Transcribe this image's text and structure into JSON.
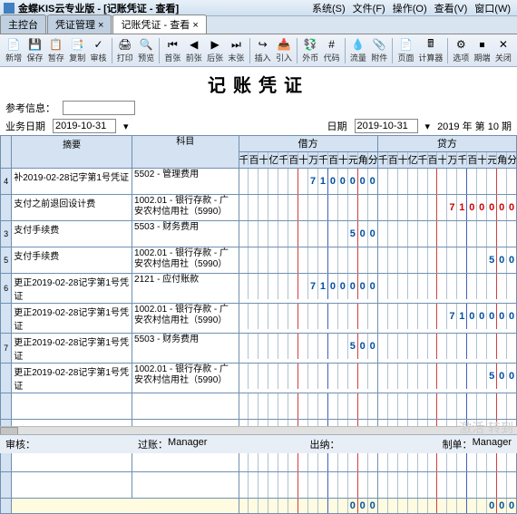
{
  "window": {
    "title": "金蝶KIS云专业版 - [记账凭证 - 查看]",
    "menus": [
      "系统(S)",
      "文件(F)",
      "操作(O)",
      "查看(V)",
      "窗口(W)"
    ]
  },
  "tabs": [
    {
      "label": "主控台",
      "active": false
    },
    {
      "label": "凭证管理 ×",
      "active": false
    },
    {
      "label": "记账凭证 - 查看 ×",
      "active": true
    }
  ],
  "toolbar": [
    {
      "name": "new",
      "icon": "📄",
      "label": "新增"
    },
    {
      "name": "save",
      "icon": "💾",
      "label": "保存"
    },
    {
      "name": "saveas",
      "icon": "📋",
      "label": "暂存"
    },
    {
      "name": "copy",
      "icon": "📑",
      "label": "复制"
    },
    {
      "name": "check",
      "icon": "✓",
      "label": "审核"
    },
    {
      "sep": true
    },
    {
      "name": "print",
      "icon": "🖨",
      "label": "打印"
    },
    {
      "name": "preview",
      "icon": "🔍",
      "label": "预览"
    },
    {
      "sep": true
    },
    {
      "name": "first",
      "icon": "⏮",
      "label": "首张"
    },
    {
      "name": "prev",
      "icon": "◀",
      "label": "前张"
    },
    {
      "name": "next",
      "icon": "▶",
      "label": "后张"
    },
    {
      "name": "last",
      "icon": "⏭",
      "label": "末张"
    },
    {
      "sep": true
    },
    {
      "name": "insert",
      "icon": "↪",
      "label": "插入"
    },
    {
      "name": "import",
      "icon": "📥",
      "label": "引入"
    },
    {
      "sep": true
    },
    {
      "name": "fx",
      "icon": "💱",
      "label": "外币"
    },
    {
      "name": "code",
      "icon": "#",
      "label": "代码"
    },
    {
      "sep": true
    },
    {
      "name": "flow",
      "icon": "💧",
      "label": "流量"
    },
    {
      "name": "attach",
      "icon": "📎",
      "label": "附件"
    },
    {
      "sep": true
    },
    {
      "name": "page",
      "icon": "📄",
      "label": "页面"
    },
    {
      "name": "calc",
      "icon": "🖩",
      "label": "计算器"
    },
    {
      "sep": true
    },
    {
      "name": "option",
      "icon": "⚙",
      "label": "选项"
    },
    {
      "name": "end",
      "icon": "⏹",
      "label": "期端"
    },
    {
      "name": "close",
      "icon": "✕",
      "label": "关闭"
    }
  ],
  "doc": {
    "title": "记账凭证",
    "ref_label": "参考信息：",
    "bizdate_label": "业务日期",
    "bizdate": "2019-10-31",
    "date_label": "日期",
    "date": "2019-10-31",
    "period": "2019 年 第 10 期"
  },
  "columns": {
    "summary": "摘要",
    "account": "科目",
    "debit": "借方",
    "credit": "贷方",
    "digits": [
      "千",
      "百",
      "十",
      "亿",
      "千",
      "百",
      "十",
      "万",
      "千",
      "百",
      "十",
      "元",
      "角",
      "分"
    ]
  },
  "rows": [
    {
      "n": "4",
      "summary": "补2019-02-28记字第1号凭证",
      "account": "5502 - 管理费用",
      "debit": "7100000",
      "credit": ""
    },
    {
      "n": "",
      "summary": "支付之前退回设计费",
      "account": "1002.01 - 银行存款 - 广安农村信用社（5990）",
      "debit": "",
      "credit": "7100000",
      "credit_neg": true
    },
    {
      "n": "3",
      "summary": "支付手续费",
      "account": "5503 - 财务费用",
      "debit": "500",
      "credit": ""
    },
    {
      "n": "5",
      "summary": "支付手续费",
      "account": "1002.01 - 银行存款 - 广安农村信用社（5990）",
      "debit": "",
      "credit": "500"
    },
    {
      "n": "6",
      "summary": "更正2019-02-28记字第1号凭证",
      "account": "2121 - 应付账款",
      "debit": "7100000",
      "credit": ""
    },
    {
      "n": "",
      "summary": "更正2019-02-28记字第1号凭证",
      "account": "1002.01 - 银行存款 - 广安农村信用社（5990）",
      "debit": "",
      "credit": "7100000"
    },
    {
      "n": "7",
      "summary": "更正2019-02-28记字第1号凭证",
      "account": "5503 - 财务费用",
      "debit": "500",
      "credit": ""
    },
    {
      "n": "",
      "summary": "更正2019-02-28记字第1号凭证",
      "account": "1002.01 - 银行存款 - 广安农村信用社（5990）",
      "debit": "",
      "credit": "500"
    },
    {
      "n": "",
      "summary": "",
      "account": "",
      "debit": "",
      "credit": ""
    },
    {
      "n": "",
      "summary": "",
      "account": "",
      "debit": "",
      "credit": ""
    },
    {
      "n": "",
      "summary": "",
      "account": "",
      "debit": "",
      "credit": ""
    },
    {
      "n": "",
      "summary": "",
      "account": "",
      "debit": "",
      "credit": ""
    }
  ],
  "totals": {
    "debit": "000",
    "credit": "000"
  },
  "footer": {
    "auditor_label": "审核：",
    "poster_label": "过账：",
    "poster": "Manager",
    "cashier_label": "出纳：",
    "preparer_label": "制单：",
    "preparer": "Manager"
  },
  "watermark": "激活\n转到"
}
